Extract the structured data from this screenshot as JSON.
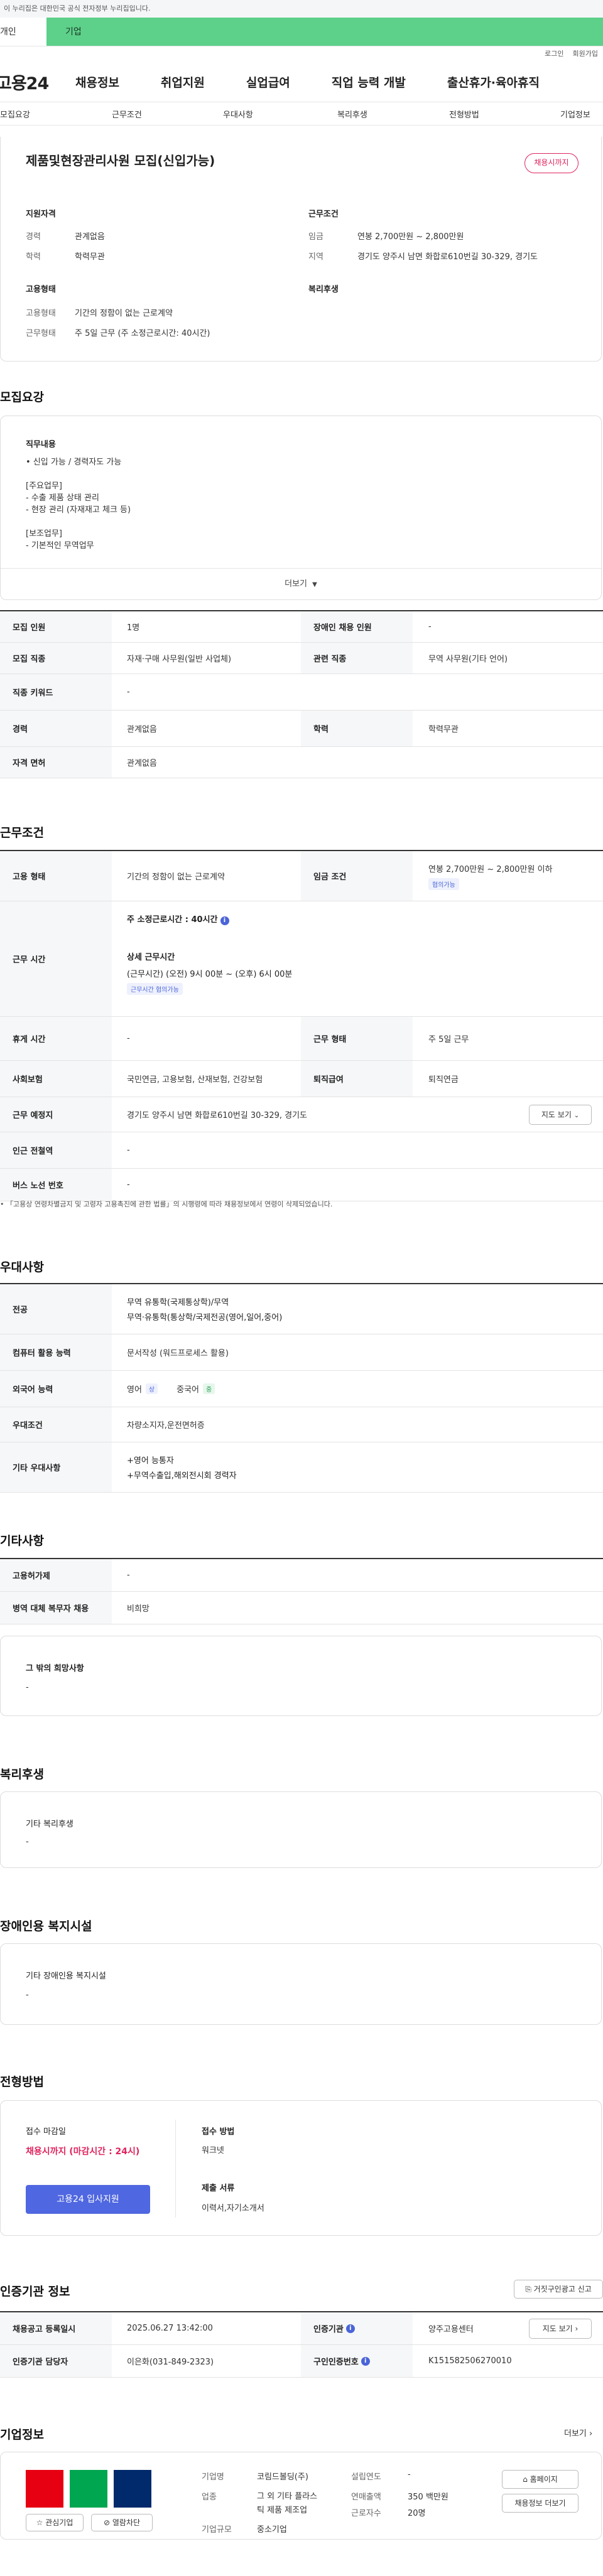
{
  "gov_banner": "이 누리집은 대한민국 공식 전자정부 누리집입니다.",
  "user_tabs": {
    "personal": "개인",
    "company": "기업"
  },
  "util": {
    "login": "로그인",
    "signup": "회원가입"
  },
  "logo": "고용24",
  "gnb": [
    "채용정보",
    "취업지원",
    "실업급여",
    "직업 능력 개발",
    "출산휴가·육아휴직"
  ],
  "lnb": [
    "모집요강",
    "근무조건",
    "우대사항",
    "복리후생",
    "전형방법",
    "기업정보"
  ],
  "summary": {
    "title": "제품및현장관리사원 모집(신입가능)",
    "deadline_badge": "채용시까지",
    "qual_heading": "지원자격",
    "exp_k": "경력",
    "exp_v": "관계없음",
    "edu_k": "학력",
    "edu_v": "학력무관",
    "cond_heading": "근무조건",
    "wage_k": "임금",
    "wage_v": "연봉 2,700만원 ~ 2,800만원",
    "region_k": "지역",
    "region_v": "경기도 양주시 남면 화합로610번길 30-329, 경기도",
    "emp_heading": "고용형태",
    "type_k": "고용형태",
    "type_v": "기간의 정함이 없는 근로계약",
    "work_k": "근무형태",
    "work_v": "주 5일 근무 (주 소정근로시간: 40시간)",
    "welfare_heading": "복리후생"
  },
  "recruit": {
    "heading": "모집요강",
    "job_heading": "직무내용",
    "job_lines": [
      "• 신입 가능 / 경력자도 가능",
      "",
      "[주요업무]",
      "- 수출 제품 상태 관리",
      "- 현장 관리 (자재재고 체크 등)",
      "",
      "[보조업무]",
      "- 기본적인 무역업무"
    ],
    "more": "더보기",
    "rows": [
      {
        "k1": "모집 인원",
        "v1": "1명",
        "k2": "장애인 채용 인원",
        "v2": "-"
      },
      {
        "k1": "모집 직종",
        "v1": "자재·구매 사무원(일반 사업체)",
        "k2": "관련 직종",
        "v2": "무역 사무원(기타 언어)"
      },
      {
        "k1": "직종 키워드",
        "v1": "-"
      },
      {
        "k1": "경력",
        "v1": "관계없음",
        "k2": "학력",
        "v2": "학력무관"
      },
      {
        "k1": "자격 면허",
        "v1": "관계없음"
      }
    ]
  },
  "cond": {
    "heading": "근무조건",
    "emp_k": "고용 형태",
    "emp_v": "기간의 정함이 없는 근로계약",
    "wage_k": "임금 조건",
    "wage_v": "연봉 2,700만원 ~ 2,800만원 이하",
    "wage_tag": "협의가능",
    "time_k": "근무 시간",
    "time_total": "주 소정근로시간 : 40시간",
    "time_detail_h": "상세 근무시간",
    "time_detail_v": "(근무시간) (오전) 9시 00분 ~ (오후) 6시 00분",
    "time_tag": "근무시간 협의가능",
    "rest_k": "휴게 시간",
    "rest_v": "-",
    "form_k": "근무 형태",
    "form_v": "주 5일 근무",
    "ins_k": "사회보험",
    "ins_v": "국민연금, 고용보험, 산재보험, 건강보험",
    "ret_k": "퇴직급여",
    "ret_v": "퇴직연금",
    "place_k": "근무 예정지",
    "place_v": "경기도 양주시 남면 화합로610번길 30-329, 경기도",
    "map_btn": "지도 보기",
    "station_k": "인근 전철역",
    "station_v": "-",
    "bus_k": "버스 노선 번호",
    "bus_v": "-",
    "note": "「고용상 연령차별금지 및 고령자 고용촉진에 관한 법률」의 시행령에 따라 채용정보에서 연령이 삭제되었습니다."
  },
  "pref": {
    "heading": "우대사항",
    "major_k": "전공",
    "major_v1": "무역 유통학(국제통상학)/무역",
    "major_v2": "무역·유통학(통상학/국제전공(영어,일어,중어)",
    "pc_k": "컴퓨터 활용 능력",
    "pc_v": "문서작성 (워드프로세스 활용)",
    "lang_k": "외국어 능력",
    "lang1": "영어",
    "lang1_tag": "상",
    "lang2": "중국어",
    "lang2_tag": "중",
    "cond_k": "우대조건",
    "cond_v": "차량소지자,운전면허증",
    "etc_k": "기타 우대사항",
    "etc_v1": "+영어 능통자",
    "etc_v2": "+무역수출입,해외전시회 경력자"
  },
  "etc": {
    "heading": "기타사항",
    "hire_k": "고용허가제",
    "hire_v": "-",
    "mil_k": "병역 대체 복무자 채용",
    "mil_v": "비희망",
    "other_h": "그 밖의 희망사항",
    "other_v": "-"
  },
  "welfare": {
    "heading": "복리후생",
    "box_h": "기타 복리후생",
    "box_v": "-"
  },
  "disabled": {
    "heading": "장애인용 복지시설",
    "box_h": "기타 장애인용 복지시설",
    "box_v": "-"
  },
  "screening": {
    "heading": "전형방법",
    "deadline_h": "접수 마감일",
    "deadline_v": "채용시까지 (마감시간 : 24시)",
    "apply_btn": "고용24 입사지원",
    "method_h": "접수 방법",
    "method_v": "워크넷",
    "docs_h": "제출 서류",
    "docs_v": "이력서,자기소개서"
  },
  "agency": {
    "heading": "인증기관 정보",
    "report_btn": "거짓구인광고 신고",
    "reg_k": "채용공고 등록일시",
    "reg_v": "2025.06.27 13:42:00",
    "org_k": "인증기관",
    "org_v": "양주고용센터",
    "map_btn": "지도 보기",
    "mgr_k": "인증기관 담당자",
    "mgr_v": "이은화(031-849-2323)",
    "no_k": "구인인증번호",
    "no_v": "K151582506270010"
  },
  "company": {
    "heading": "기업정보",
    "more": "더보기",
    "fav_btn": "관심기업",
    "block_btn": "열람차단",
    "home_btn": "홈페이지",
    "jobs_btn": "채용정보 더보기",
    "name_k": "기업명",
    "name_v": "코림드볼딩(주)",
    "ind_k": "업종",
    "ind_v1": "그 외 기타 플라스",
    "ind_v2": "틱 제품 제조업",
    "size_k": "기업규모",
    "size_v": "중소기업",
    "est_k": "설립연도",
    "est_v": "-",
    "sales_k": "연매출액",
    "sales_v": "350 백만원",
    "emp_k": "근로자수",
    "emp_v": "20명",
    "logo_colors": [
      "#e60012",
      "#00a650",
      "#002a6c"
    ]
  }
}
